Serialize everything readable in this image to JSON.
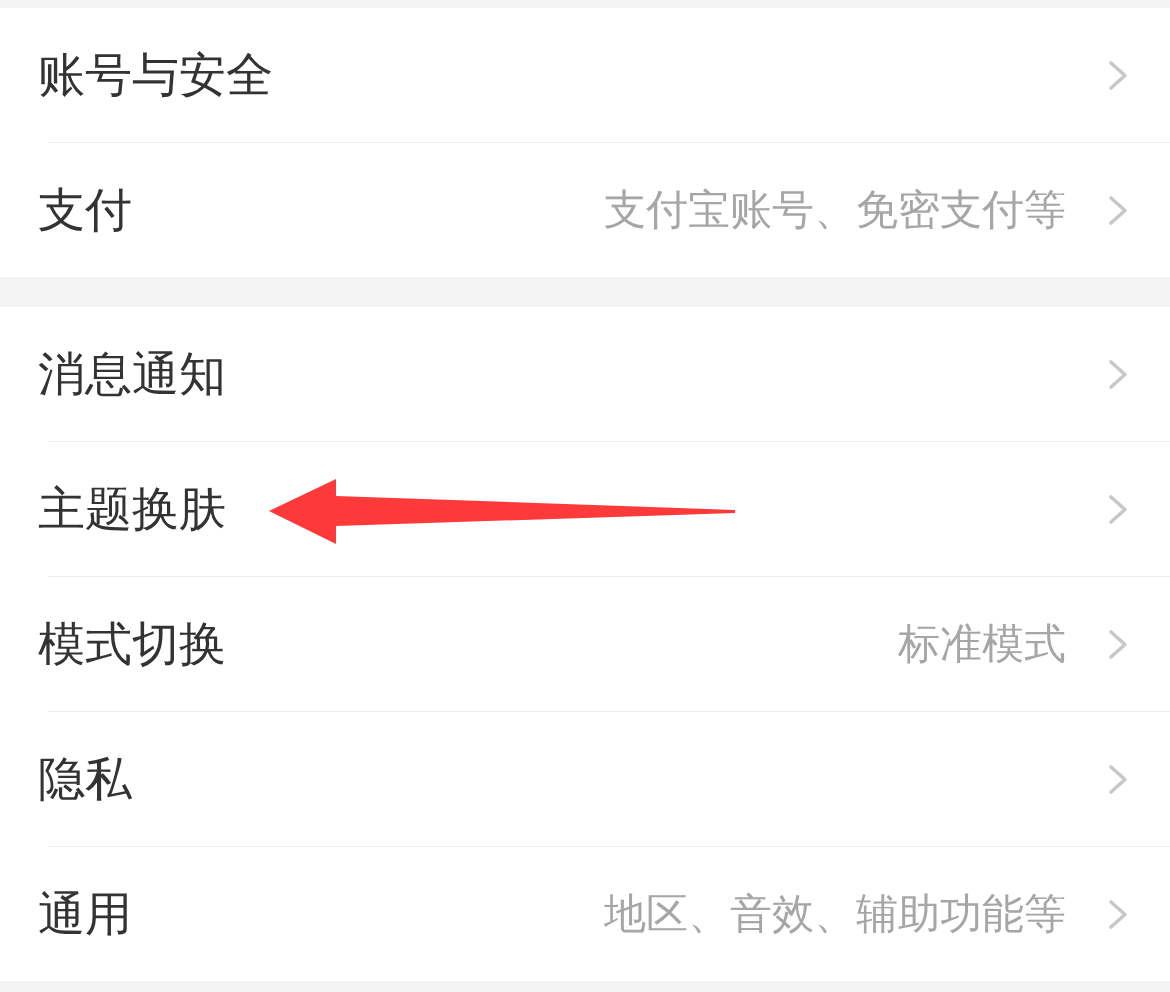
{
  "groups": [
    {
      "items": [
        {
          "label": "账号与安全",
          "annotation_arrow": false
        },
        {
          "label": "支付",
          "value": "支付宝账号、免密支付等",
          "annotation_arrow": false
        }
      ]
    },
    {
      "items": [
        {
          "label": "消息通知",
          "annotation_arrow": false
        },
        {
          "label": "主题换肤",
          "annotation_arrow": true
        },
        {
          "label": "模式切换",
          "value": "标准模式",
          "annotation_arrow": false
        },
        {
          "label": "隐私",
          "annotation_arrow": false
        },
        {
          "label": "通用",
          "value": "地区、音效、辅助功能等",
          "annotation_arrow": false
        }
      ]
    }
  ]
}
